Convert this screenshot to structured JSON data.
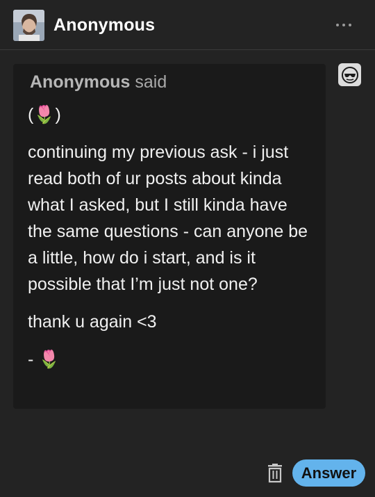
{
  "header": {
    "username": "Anonymous",
    "avatar_icon": "user-avatar-photo",
    "menu_icon": "more-dots-icon"
  },
  "ask": {
    "asker_name": "Anonymous",
    "said_label": "said",
    "badge_icon": "anonymous-sunglasses-icon",
    "paragraphs": [
      "(🌷)",
      "continuing my previous ask - i just read both of ur posts about kinda what I asked, but I still kinda have the same questions - can anyone be a little, how do i start, and is it possible that I’m just not one?",
      "thank u again <3",
      "- 🌷"
    ]
  },
  "footer": {
    "delete_icon": "trash-icon",
    "answer_label": "Answer",
    "accent_color": "#63b3ec"
  }
}
